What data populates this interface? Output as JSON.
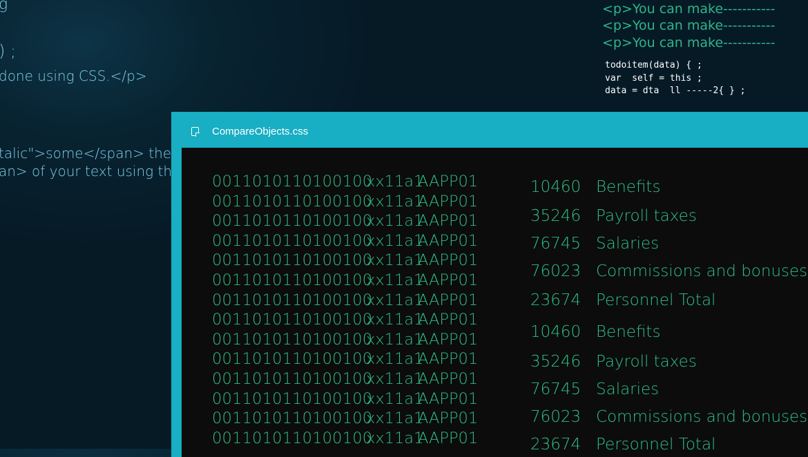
{
  "background_code": {
    "lines": [
      "g",
      ") ;",
      "done using CSS.</p>",
      "talic\">some</span> the l",
      "an> of your text using the"
    ],
    "top_right_html": [
      "<p>You can make-----------",
      "<p>You can make-----------",
      "<p>You can make-----------"
    ],
    "top_right_js": [
      "todoitem(data) { ;",
      "var  self = this ;",
      "data = dta  ll -----2{ } ;"
    ]
  },
  "window": {
    "title": "CompareObjects.css",
    "accent_color": "#18aec4",
    "text_color": "#2fc088",
    "binary_rows": [
      {
        "bin": "0011010110100100",
        "x": "xx11a1",
        "code": "AAPP01"
      },
      {
        "bin": "0011010110100100",
        "x": "xx11a1",
        "code": "AAPP01"
      },
      {
        "bin": "0011010110100100",
        "x": "xx11a1",
        "code": "AAPP01"
      },
      {
        "bin": "0011010110100100",
        "x": "xx11a1",
        "code": "AAPP01"
      },
      {
        "bin": "0011010110100100",
        "x": "xx11a1",
        "code": "AAPP01"
      },
      {
        "bin": "0011010110100100",
        "x": "xx11a1",
        "code": "AAPP01"
      },
      {
        "bin": "0011010110100100",
        "x": "xx11a1",
        "code": "AAPP01"
      },
      {
        "bin": "0011010110100100",
        "x": "xx11a1",
        "code": "AAPP01"
      },
      {
        "bin": "0011010110100100",
        "x": "xx11a1",
        "code": "AAPP01"
      },
      {
        "bin": "0011010110100100",
        "x": "xx11a1",
        "code": "AAPP01"
      },
      {
        "bin": "0011010110100100",
        "x": "xx11a1",
        "code": "AAPP01"
      },
      {
        "bin": "0011010110100100",
        "x": "xx11a1",
        "code": "AAPP01"
      },
      {
        "bin": "0011010110100100",
        "x": "xx11a1",
        "code": "AAPP01"
      },
      {
        "bin": "0011010110100100",
        "x": "xx11a1",
        "code": "AAPP01"
      }
    ],
    "ledger": [
      {
        "num": "10460",
        "label": "Benefits"
      },
      {
        "num": "35246",
        "label": "Payroll taxes"
      },
      {
        "num": "76745",
        "label": "Salaries"
      },
      {
        "num": "76023",
        "label": "Commissions and bonuses"
      },
      {
        "num": "23674",
        "label": "Personnel Total"
      },
      {
        "num": "10460",
        "label": "Benefits"
      },
      {
        "num": "35246",
        "label": "Payroll taxes"
      },
      {
        "num": "76745",
        "label": "Salaries"
      },
      {
        "num": "76023",
        "label": "Commissions and bonuses"
      },
      {
        "num": "23674",
        "label": "Personnel Total"
      }
    ]
  }
}
